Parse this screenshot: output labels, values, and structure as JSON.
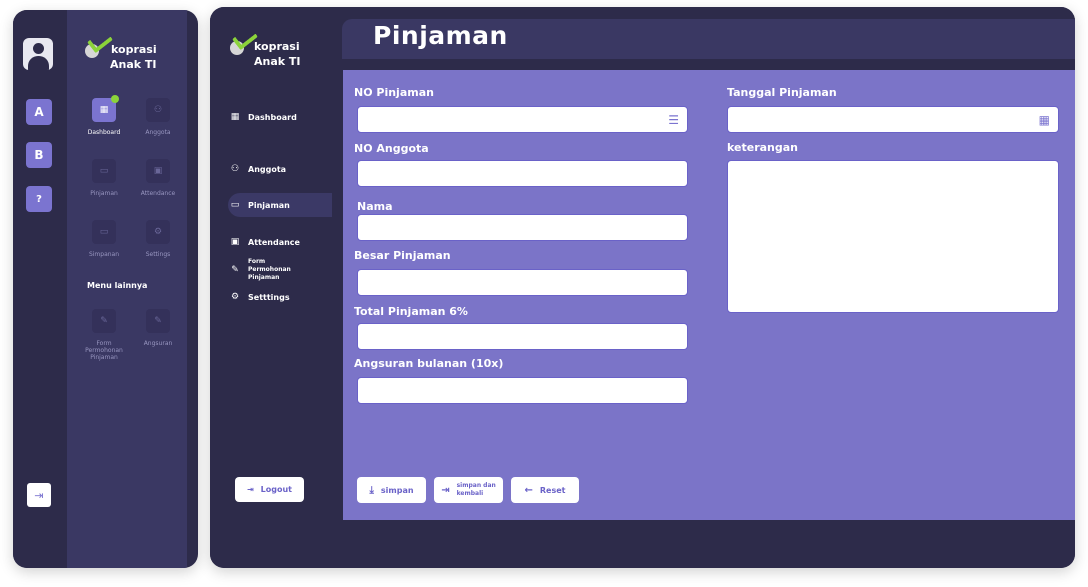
{
  "brand": {
    "line1": "koprasi",
    "line2": "Anak TI"
  },
  "mock": {
    "rail": [
      "A",
      "B"
    ],
    "grid": [
      {
        "label": "Dashboard",
        "icon": "dashboard-icon",
        "glyph": "▦",
        "active": true
      },
      {
        "label": "Anggota",
        "icon": "users-icon",
        "glyph": "⚇",
        "active": false
      },
      {
        "label": "Pinjaman",
        "icon": "money-icon",
        "glyph": "▭",
        "active": false
      },
      {
        "label": "Attendance",
        "icon": "calendar-icon",
        "glyph": "▣",
        "active": false
      },
      {
        "label": "Simpanan",
        "icon": "savings-icon",
        "glyph": "▭",
        "active": false
      },
      {
        "label": "Settings",
        "icon": "gear-icon",
        "glyph": "⚙",
        "active": false
      }
    ],
    "menu_lainnya": "Menu lainnya",
    "other_items": [
      {
        "label": "Form Permohonan Pinjaman",
        "icon": "form-icon",
        "glyph": "✎"
      },
      {
        "label": "Angsuran",
        "icon": "form-icon",
        "glyph": "✎"
      }
    ]
  },
  "sidebar": {
    "items": [
      {
        "label": "Dashboard",
        "icon": "dashboard-icon",
        "glyph": "▦"
      },
      {
        "label": "Anggota",
        "icon": "users-icon",
        "glyph": "⚇"
      },
      {
        "label": "Pinjaman",
        "icon": "money-icon",
        "glyph": "▭"
      },
      {
        "label": "Attendance",
        "icon": "calendar-icon",
        "glyph": "▣"
      },
      {
        "label": "Form Permohonan Pinjaman",
        "icon": "form-icon",
        "glyph": "✎"
      },
      {
        "label": "Setttings",
        "icon": "gear-icon",
        "glyph": "⚙"
      }
    ],
    "logout": "Logout"
  },
  "page": {
    "title": "Pinjaman"
  },
  "form": {
    "no_pinjaman": {
      "label": "NO Pinjaman",
      "value": ""
    },
    "no_anggota": {
      "label": "NO Anggota",
      "value": ""
    },
    "nama": {
      "label": "Nama",
      "value": ""
    },
    "besar_pinjaman": {
      "label": "Besar Pinjaman",
      "value": ""
    },
    "total_pinjaman": {
      "label": "Total Pinjaman 6%",
      "value": ""
    },
    "angsuran": {
      "label": "Angsuran bulanan (10x)",
      "value": ""
    },
    "tanggal": {
      "label": "Tanggal Pinjaman",
      "value": ""
    },
    "keterangan": {
      "label": "keterangan",
      "value": ""
    }
  },
  "actions": {
    "simpan": "simpan",
    "simpan_kembali_1": "simpan dan",
    "simpan_kembali_2": "kembali",
    "reset": "Reset"
  },
  "colors": {
    "accent": "#7b74c8",
    "dark": "#2d2b4a",
    "panel": "#3a3863",
    "check": "#8bd33a"
  }
}
